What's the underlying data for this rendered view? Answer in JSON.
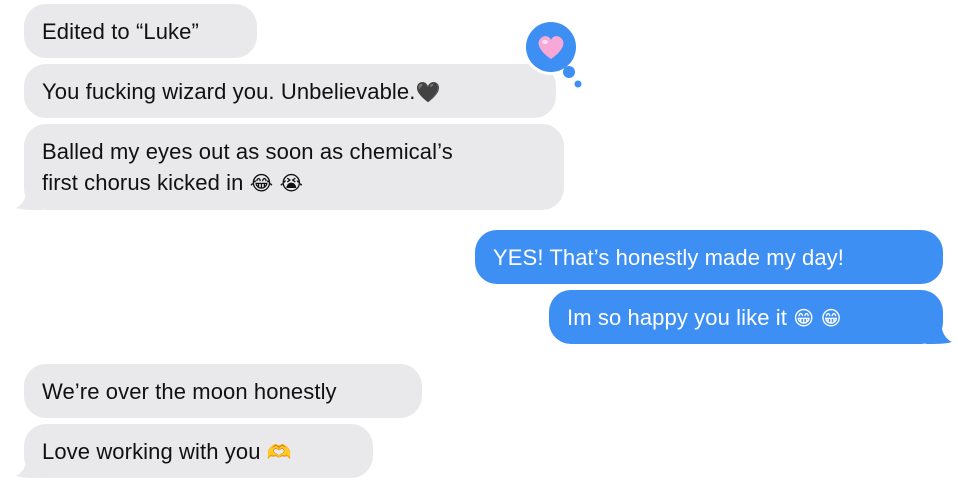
{
  "conversation": {
    "messages": [
      {
        "direction": "incoming",
        "lines": [
          "Edited to “Luke”"
        ]
      },
      {
        "direction": "incoming",
        "lines": [
          "You fucking wizard you. Unbelievable."
        ],
        "emoji": "🖤",
        "reaction": "pink-heart"
      },
      {
        "direction": "incoming",
        "lines": [
          "Balled my eyes out as soon as chemical’s",
          "first chorus kicked in"
        ],
        "emoji": "😂 😭"
      },
      {
        "direction": "outgoing",
        "lines": [
          "YES! That’s honestly made my day!"
        ]
      },
      {
        "direction": "outgoing",
        "lines": [
          "Im so happy you like it"
        ],
        "emoji": "😁 😁"
      },
      {
        "direction": "incoming",
        "lines": [
          "We’re over the moon honestly"
        ]
      },
      {
        "direction": "incoming",
        "lines": [
          "Love working with you"
        ],
        "emoji": "🫶"
      }
    ]
  },
  "colors": {
    "incoming_bubble": "#e9e9eb",
    "outgoing_bubble": "#3d8ff4",
    "reaction_bubble": "#3d8ff4",
    "reaction_heart": "#f7a8d6"
  }
}
